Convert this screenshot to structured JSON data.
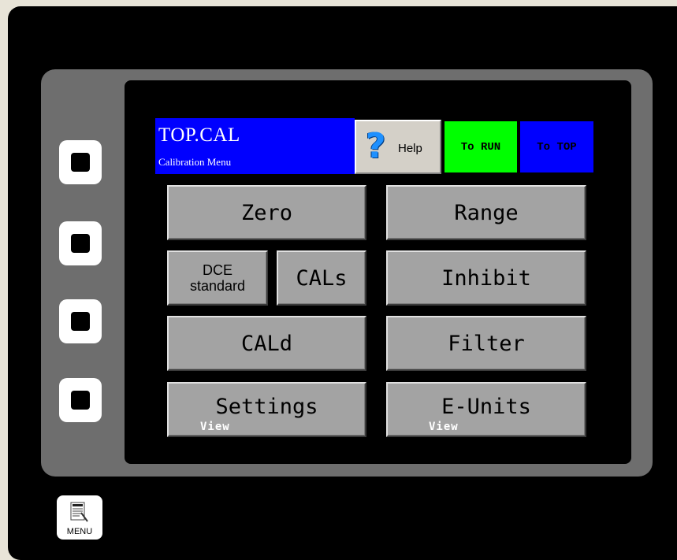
{
  "header": {
    "title": "TOP.CAL",
    "subtitle": "Calibration Menu",
    "help_label": "Help",
    "to_run_label": "To RUN",
    "to_top_label": "To TOP"
  },
  "buttons": {
    "zero": "Zero",
    "range": "Range",
    "dce_line1": "DCE",
    "dce_line2": "standard",
    "cals": "CALs",
    "inhibit": "Inhibit",
    "cald": "CALd",
    "filter": "Filter",
    "settings": "Settings",
    "settings_sub": "View",
    "eunits": "E-Units",
    "eunits_sub": "View"
  },
  "menu": {
    "label": "MENU"
  },
  "colors": {
    "title_bg": "#0000ff",
    "to_run_bg": "#00ff00",
    "to_top_bg": "#0000ff",
    "button_bg": "#a3a3a3",
    "screen_bg": "#000000",
    "bezel": "#6e6e6e"
  },
  "icons": {
    "help": "question-mark-icon",
    "menu": "menu-document-icon"
  }
}
